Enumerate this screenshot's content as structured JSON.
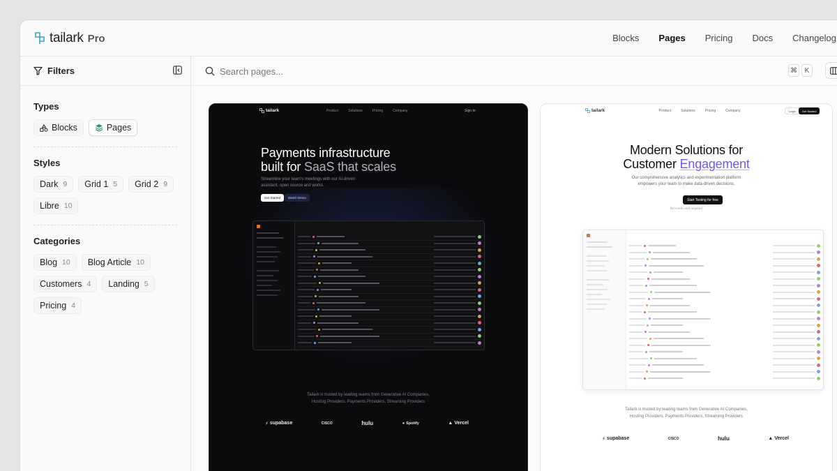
{
  "app": {
    "logo_name": "tailark",
    "logo_suffix": "Pro"
  },
  "nav": {
    "items": [
      "Blocks",
      "Pages",
      "Pricing",
      "Docs",
      "Changelog"
    ],
    "active": "Pages"
  },
  "sidebar": {
    "filters_label": "Filters",
    "types": {
      "title": "Types",
      "items": [
        {
          "label": "Blocks",
          "icon": "shapes-icon"
        },
        {
          "label": "Pages",
          "icon": "layers-icon",
          "selected": true
        }
      ]
    },
    "styles": {
      "title": "Styles",
      "items": [
        {
          "label": "Dark",
          "count": "9"
        },
        {
          "label": "Grid 1",
          "count": "5"
        },
        {
          "label": "Grid 2",
          "count": "9"
        },
        {
          "label": "Libre",
          "count": "10"
        }
      ]
    },
    "categories": {
      "title": "Categories",
      "items": [
        {
          "label": "Blog",
          "count": "10"
        },
        {
          "label": "Blog Article",
          "count": "10"
        },
        {
          "label": "Customers",
          "count": "4"
        },
        {
          "label": "Landing",
          "count": "5"
        },
        {
          "label": "Pricing",
          "count": "4"
        }
      ]
    }
  },
  "search": {
    "placeholder": "Search pages...",
    "kbd_cmd": "⌘",
    "kbd_key": "K"
  },
  "cards": {
    "dark": {
      "logo": "tailark",
      "nav": [
        "Product",
        "Solutions",
        "Pricing",
        "Company"
      ],
      "signin": "Sign In",
      "title_line1": "Payments infrastructure",
      "title_line2_a": "built for ",
      "title_line2_b": "SaaS that scales",
      "subtitle": "Streamline your team's meetings with our AI-driven assistant, open source and works.",
      "btn_primary": "Get Started",
      "btn_secondary": "Watch Demo",
      "trusted_line1": "Tailark is trusted by leading teams from Generative AI Companies,",
      "trusted_line2": "Hosting Providers, Payments Providers, Streaming Providers",
      "brands": [
        "supabase",
        "CISCO",
        "hulu",
        "Spotify",
        "Vercel"
      ]
    },
    "light": {
      "logo": "tailark",
      "nav": [
        "Product",
        "Solutions",
        "Pricing",
        "Company"
      ],
      "login": "Login",
      "get_started": "Get Started",
      "title_line1": "Modern Solutions for",
      "title_line2_a": "Customer ",
      "title_line2_b": "Engagement",
      "subtitle_line1": "Our comprehensive analytics and experimentation platform",
      "subtitle_line2": "empowers your team to make data-driven decisions.",
      "cta": "Start Testing for free",
      "cta_note": "No credit card required",
      "trusted_line1": "Tailark is trusted by leading teams from Generative AI Companies,",
      "trusted_line2": "Hosting Providers, Payments Providers, Streaming Providers",
      "brands": [
        "supabase",
        "CISCO",
        "hulu",
        "Vercel"
      ]
    }
  },
  "colors": {
    "accent": "#6a5ce6",
    "dark_card_bg": "#0b0b0d",
    "brand_logo": "#3aa0c8"
  }
}
